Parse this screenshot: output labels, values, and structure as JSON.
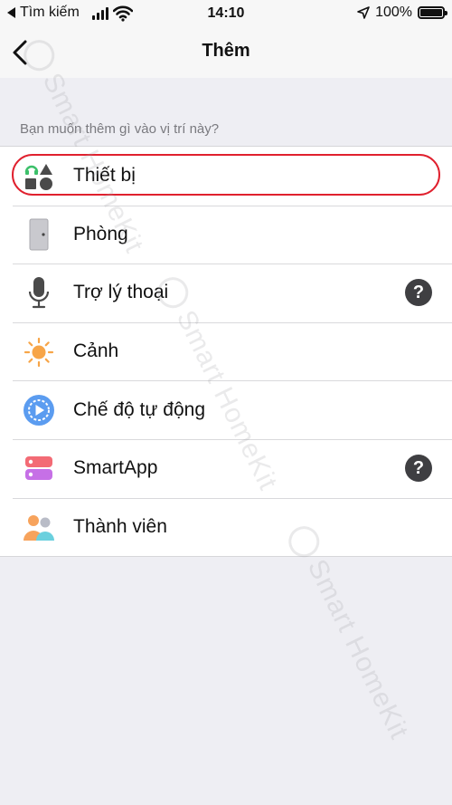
{
  "status_bar": {
    "back_app": "Tìm kiếm",
    "time": "14:10",
    "battery": "100%"
  },
  "nav": {
    "title": "Thêm"
  },
  "section_header": "Bạn muốn thêm gì vào vị trí này?",
  "items": [
    {
      "label": "Thiết bị",
      "icon": "device-icon",
      "highlighted": true
    },
    {
      "label": "Phòng",
      "icon": "door-icon"
    },
    {
      "label": "Trợ lý thoại",
      "icon": "microphone-icon",
      "help": "?"
    },
    {
      "label": "Cảnh",
      "icon": "sun-icon"
    },
    {
      "label": "Chế độ tự động",
      "icon": "play-clock-icon"
    },
    {
      "label": "SmartApp",
      "icon": "smartapp-icon",
      "help": "?"
    },
    {
      "label": "Thành viên",
      "icon": "members-icon"
    }
  ],
  "watermark": "Smart HomeKit",
  "colors": {
    "highlight": "#e0202e",
    "background": "#eeeef3"
  }
}
